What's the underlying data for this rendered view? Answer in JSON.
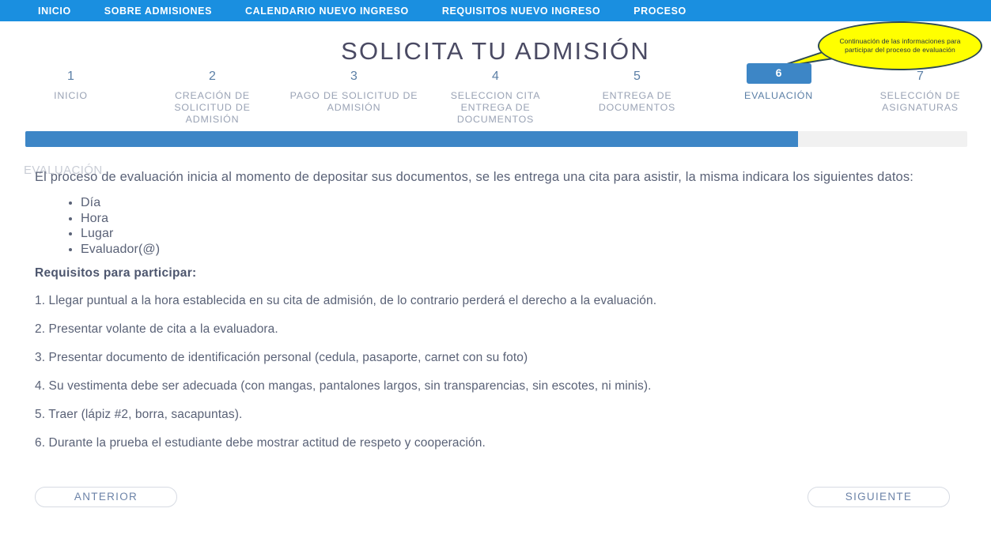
{
  "topnav": {
    "items": [
      {
        "label": "INICIO",
        "name": "nav-inicio"
      },
      {
        "label": "SOBRE ADMISIONES",
        "name": "nav-sobre-admisiones"
      },
      {
        "label": "CALENDARIO NUEVO INGRESO",
        "name": "nav-calendario-nuevo-ingreso"
      },
      {
        "label": "REQUISITOS NUEVO INGRESO",
        "name": "nav-requisitos-nuevo-ingreso"
      },
      {
        "label": "PROCESO",
        "name": "nav-proceso"
      }
    ],
    "background_color": "#1a8fe0"
  },
  "page": {
    "title": "SOLICITA TU ADMISIÓN"
  },
  "callout": {
    "text": "Continuación de las informaciones para participar del proceso de evaluación",
    "fill_color": "#ffff00",
    "border_color": "#2d4a55"
  },
  "stepper": {
    "active_index": 5,
    "active_color": "#3d86c6",
    "steps": [
      {
        "number": "1",
        "label": "INICIO"
      },
      {
        "number": "2",
        "label": "CREACIÓN DE SOLICITUD DE ADMISIÓN"
      },
      {
        "number": "3",
        "label": "PAGO DE SOLICITUD DE ADMISIÓN"
      },
      {
        "number": "4",
        "label": "SELECCION CITA ENTREGA DE DOCUMENTOS"
      },
      {
        "number": "5",
        "label": "ENTREGA DE DOCUMENTOS"
      },
      {
        "number": "6",
        "label": "EVALUACIÓN"
      },
      {
        "number": "7",
        "label": "SELECCIÓN DE ASIGNATURAS"
      }
    ]
  },
  "progress": {
    "percent": 82,
    "percent_label": "82%",
    "fill_color": "#3d86c6",
    "track_color": "#f1f1f1"
  },
  "content": {
    "section_heading": "EVALUACIÓN",
    "intro": "El proceso de evaluación inicia al momento de depositar sus documentos, se les entrega una cita para asistir, la misma indicara los siguientes datos:",
    "bullets": [
      "Día",
      "Hora",
      "Lugar",
      "Evaluador(@)"
    ],
    "requisitos_title": "Requisitos para participar:",
    "requisitos": [
      "1. Llegar puntual a la hora establecida en su cita de admisión, de lo contrario perderá el derecho a la evaluación.",
      "2. Presentar volante de cita a la evaluadora.",
      "3. Presentar documento de identificación personal (cedula, pasaporte, carnet con su foto)",
      "4. Su vestimenta debe ser adecuada (con mangas, pantalones largos, sin transparencias, sin escotes, ni minis).",
      "5. Traer (lápiz #2, borra, sacapuntas).",
      "6. Durante la prueba el estudiante debe mostrar actitud de respeto y cooperación."
    ]
  },
  "footer": {
    "previous_label": "ANTERIOR",
    "next_label": "SIGUIENTE"
  }
}
